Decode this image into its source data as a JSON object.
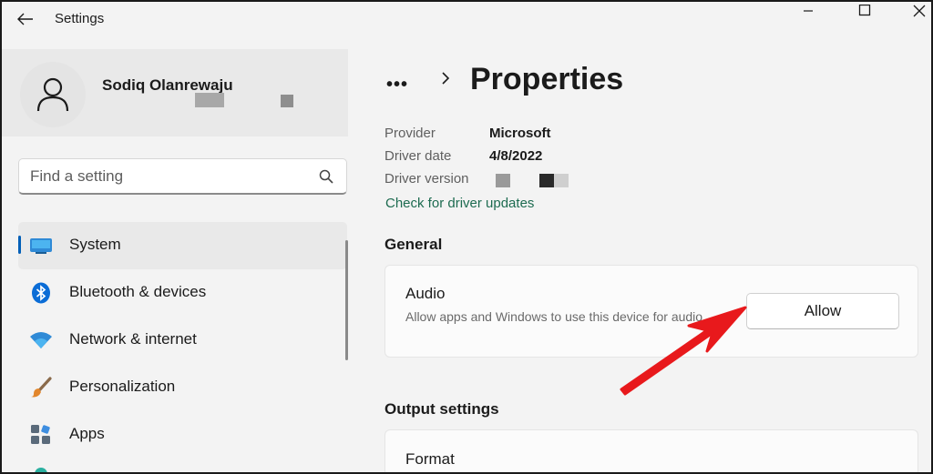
{
  "window": {
    "title": "Settings",
    "back_icon": "arrow-left-icon",
    "controls": [
      "minimize-icon",
      "maximize-icon",
      "close-icon"
    ]
  },
  "profile": {
    "name": "Sodiq Olanrewaju",
    "avatar_icon": "person-icon"
  },
  "search": {
    "placeholder": "Find a setting",
    "icon": "search-icon"
  },
  "sidebar": {
    "items": [
      {
        "label": "System",
        "icon": "monitor-icon",
        "selected": true
      },
      {
        "label": "Bluetooth & devices",
        "icon": "bluetooth-icon",
        "selected": false
      },
      {
        "label": "Network & internet",
        "icon": "wifi-icon",
        "selected": false
      },
      {
        "label": "Personalization",
        "icon": "paintbrush-icon",
        "selected": false
      },
      {
        "label": "Apps",
        "icon": "apps-icon",
        "selected": false
      }
    ]
  },
  "breadcrumb": {
    "more": "•••",
    "title": "Properties"
  },
  "properties": [
    {
      "key": "Provider",
      "value": "Microsoft"
    },
    {
      "key": "Driver date",
      "value": "4/8/2022"
    },
    {
      "key": "Driver version",
      "value": ""
    }
  ],
  "driver_link": "Check for driver updates",
  "general": {
    "heading": "General",
    "audio_title": "Audio",
    "audio_desc": "Allow apps and Windows to use this device for audio",
    "allow_label": "Allow"
  },
  "output": {
    "heading": "Output settings",
    "format_title": "Format"
  },
  "colors": {
    "accent": "#005fb8",
    "link": "#1d6b50",
    "annotation_arrow": "#e8191c"
  }
}
